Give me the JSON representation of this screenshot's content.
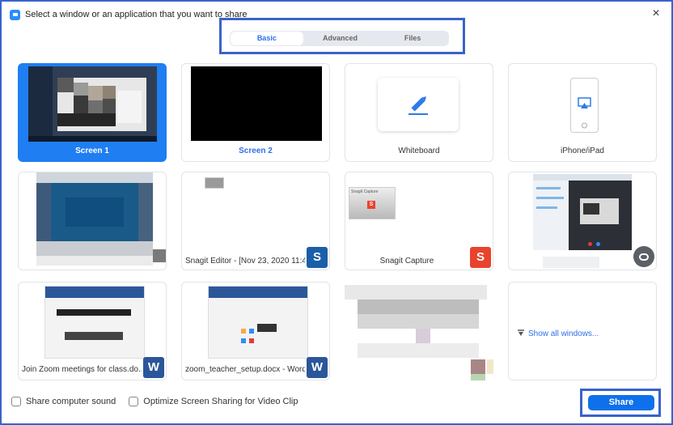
{
  "window": {
    "title": "Select a window or an application that you want to share",
    "close_glyph": "×"
  },
  "tabs": [
    {
      "label": "Basic",
      "active": true
    },
    {
      "label": "Advanced",
      "active": false
    },
    {
      "label": "Files",
      "active": false
    }
  ],
  "tiles": {
    "screen1": "Screen 1",
    "screen2": "Screen 2",
    "whiteboard": "Whiteboard",
    "iphone": "iPhone/iPad",
    "snagit_editor": "Snagit Editor - [Nov 23, 2020 11:4...",
    "snagit_capture": "Snagit Capture",
    "snagit_thumb_label": "Snagit Capture",
    "snagit_icon_glyph": "S",
    "join_zoom": "Join Zoom meetings for class.do...",
    "zoom_teacher": "zoom_teacher_setup.docx - Word",
    "word_icon_glyph": "W",
    "show_all": "Show all windows..."
  },
  "bottom": {
    "share_sound": "Share computer sound",
    "optimize": "Optimize Screen Sharing for Video Clip",
    "share_button": "Share"
  },
  "colors": {
    "accent": "#0e71eb",
    "selected_tile": "#1f7ef2",
    "annotation_border": "#3a62c9",
    "snagit_red": "#e8432d",
    "word_blue": "#2b579a"
  }
}
